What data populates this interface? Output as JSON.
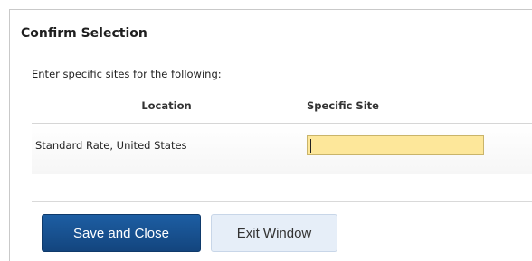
{
  "dialog": {
    "title": "Confirm Selection",
    "instructions": "Enter specific sites for the following:"
  },
  "table": {
    "columns": [
      "Location",
      "Specific Site"
    ],
    "rows": [
      {
        "location": "Standard Rate, United States",
        "specific_site": ""
      }
    ]
  },
  "buttons": {
    "save_label": "Save and Close",
    "exit_label": "Exit Window"
  },
  "colors": {
    "input_highlight": "#fde79a",
    "primary_button": "#1d5ea3",
    "secondary_button": "#e6eef8"
  }
}
